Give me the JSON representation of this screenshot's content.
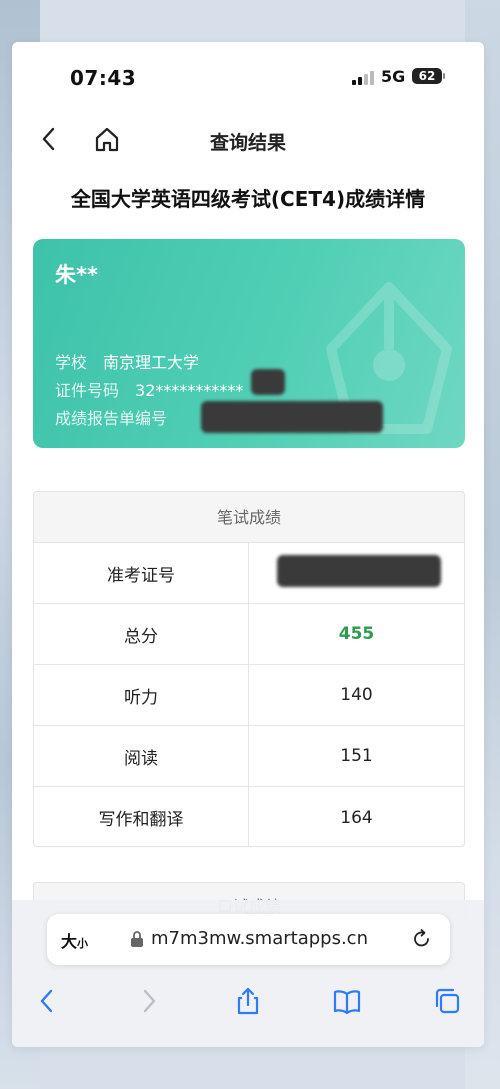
{
  "status_bar": {
    "time": "07:43",
    "network": "5G",
    "battery": "62"
  },
  "nav": {
    "title": "查询结果"
  },
  "page": {
    "heading": "全国大学英语四级考试(CET4)成绩详情"
  },
  "card": {
    "name": "朱**",
    "school_label": "学校",
    "school_value": "南京理工大学",
    "id_label": "证件号码",
    "id_value": "32***********",
    "report_label": "成绩报告单编号"
  },
  "written": {
    "title": "笔试成绩",
    "rows": [
      {
        "label": "准考证号",
        "value": ""
      },
      {
        "label": "总分",
        "value": "455"
      },
      {
        "label": "听力",
        "value": "140"
      },
      {
        "label": "阅读",
        "value": "151"
      },
      {
        "label": "写作和翻译",
        "value": "164"
      }
    ]
  },
  "oral": {
    "title": "口试成绩"
  },
  "browser": {
    "text_size_big": "大",
    "text_size_small": "小",
    "url": "m7m3mw.smartapps.cn"
  },
  "colors": {
    "card_accent": "#3ec2aa",
    "total_score": "#2e9c4e",
    "browser_icons": "#2f7bf6"
  }
}
